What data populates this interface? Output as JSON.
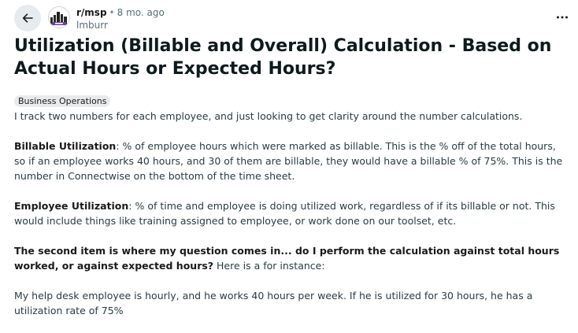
{
  "post": {
    "subreddit": "r/msp",
    "separator": "•",
    "time_ago": "8 mo. ago",
    "author": "lmburr",
    "title": "Utilization (Billable and Overall) Calculation - Based on Actual Hours or Expected Hours?",
    "flair": "Business Operations",
    "body": {
      "p1": "I track two numbers for each employee, and just looking to get clarity around the number calculations.",
      "p2_bold": "Billable Utilization",
      "p2_rest": ": % of employee hours which were marked as billable. This is the % off of the total hours, so if an employee works 40 hours, and 30 of them are billable, they would have a billable % of 75%. This is the number in Connectwise on the bottom of the time sheet.",
      "p3_bold": "Employee Utilization",
      "p3_rest": ": % of time and employee is doing utilized work, regardless of if its billable or not. This would include things like training assigned to employee, or work done on our toolset, etc.",
      "p4_bold": "The second item is where my question comes in... do I perform the calculation against total hours worked, or against expected hours?",
      "p4_rest": " Here is a for instance:",
      "p5": "My help desk employee is hourly, and he works 40 hours per week. If he is utilized for 30 hours, he has a utilization rate of 75%"
    }
  },
  "icons": {
    "back": "back-arrow-icon",
    "more": "more-options-icon",
    "avatar": "subreddit-avatar"
  }
}
